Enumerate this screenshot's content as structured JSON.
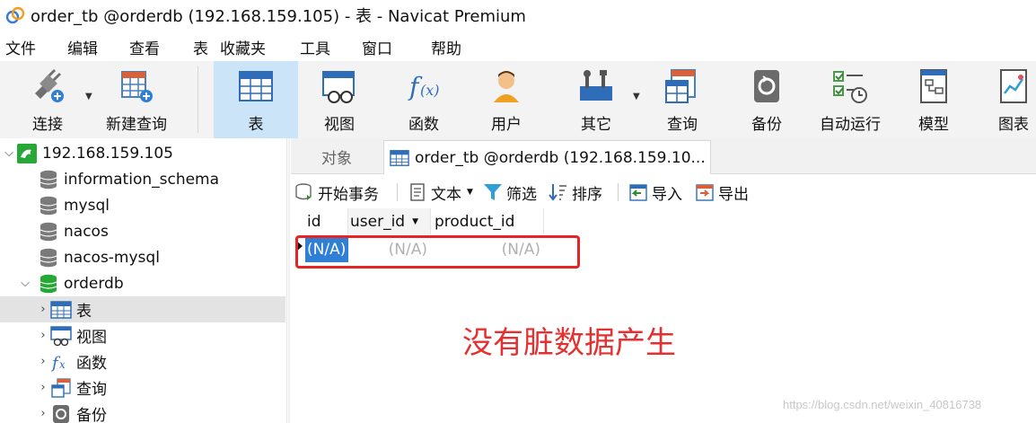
{
  "window": {
    "title": "order_tb @orderdb (192.168.159.105) - 表 - Navicat Premium"
  },
  "menu": [
    "文件",
    "编辑",
    "查看",
    "表",
    "收藏夹",
    "工具",
    "窗口",
    "帮助"
  ],
  "toolbar": {
    "items": [
      {
        "label": "连接",
        "icon": "connection-plug-icon"
      },
      {
        "label": "新建查询",
        "icon": "new-query-icon"
      },
      {
        "label": "表",
        "icon": "table-icon",
        "active": true
      },
      {
        "label": "视图",
        "icon": "view-icon"
      },
      {
        "label": "函数",
        "icon": "function-icon"
      },
      {
        "label": "用户",
        "icon": "user-icon"
      },
      {
        "label": "其它",
        "icon": "tools-icon"
      },
      {
        "label": "查询",
        "icon": "query-icon"
      },
      {
        "label": "备份",
        "icon": "backup-icon"
      },
      {
        "label": "自动运行",
        "icon": "automation-icon"
      },
      {
        "label": "模型",
        "icon": "model-icon"
      },
      {
        "label": "图表",
        "icon": "chart-icon"
      }
    ]
  },
  "tree": {
    "connection": "192.168.159.105",
    "databases": [
      "information_schema",
      "mysql",
      "nacos",
      "nacos-mysql",
      "orderdb"
    ],
    "children": [
      "表",
      "视图",
      "函数",
      "查询",
      "备份"
    ]
  },
  "tabs": {
    "objects": "对象",
    "table_tab": "order_tb @orderdb (192.168.159.10..."
  },
  "actions": {
    "begin_transaction": "开始事务",
    "text": "文本",
    "filter": "筛选",
    "sort": "排序",
    "import": "导入",
    "export": "导出"
  },
  "grid": {
    "columns": [
      "id",
      "user_id",
      "product_id"
    ],
    "row": [
      "(N/A)",
      "(N/A)",
      "(N/A)"
    ]
  },
  "annotation": "没有脏数据产生",
  "watermark": "https://blog.csdn.net/weixin_40816738",
  "colors": {
    "accent": "#2f7fd6",
    "annotation": "#e53030",
    "active_tool": "#cce4f7"
  }
}
